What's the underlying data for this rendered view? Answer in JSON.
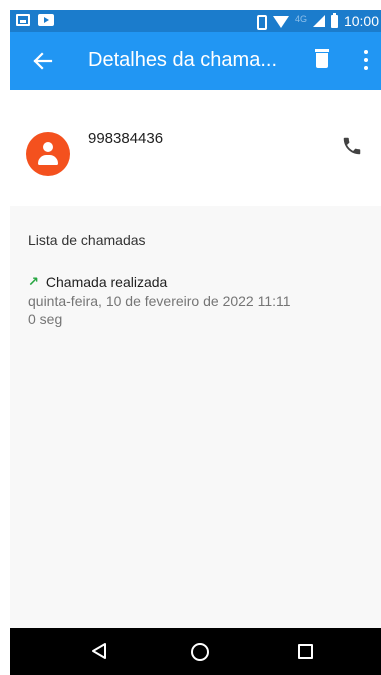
{
  "status_bar": {
    "network": "4G",
    "time": "10:00",
    "icons": [
      "image-notification-icon",
      "youtube-notification-icon",
      "vibrate-icon",
      "wifi-icon",
      "signal-icon",
      "battery-icon"
    ]
  },
  "app_bar": {
    "back_icon": "arrow-left-icon",
    "title": "Detalhes da chama...",
    "actions": [
      "delete-icon",
      "more-vert-icon"
    ],
    "color": "#2196f3"
  },
  "contact": {
    "phone_number": "998384436",
    "avatar_color": "#f4511e",
    "avatar_icon": "person-icon",
    "call_icon": "phone-icon"
  },
  "call_list": {
    "title": "Lista de chamadas",
    "entries": [
      {
        "type_icon": "outgoing-call-icon",
        "type": "Chamada realizada",
        "date": "quinta-feira, 10 de fevereiro de 2022 11:11",
        "duration": "0 seg"
      }
    ]
  },
  "nav_bar": {
    "icons": [
      "back-icon",
      "home-icon",
      "recents-icon"
    ]
  }
}
